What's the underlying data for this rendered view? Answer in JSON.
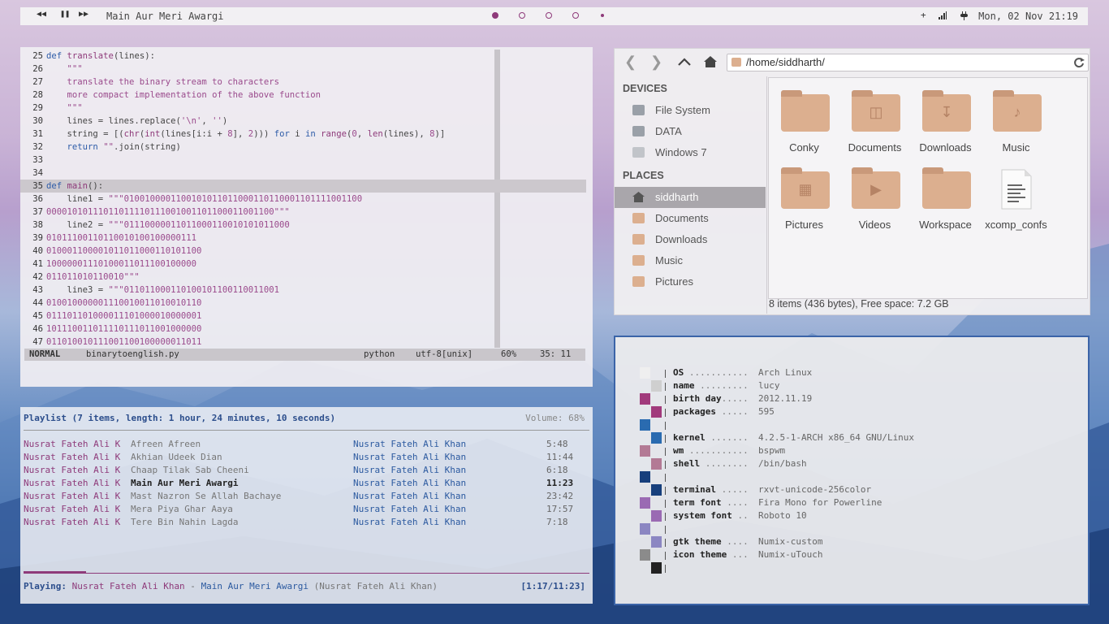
{
  "colors": {
    "accent": "#8e3a7a",
    "blue": "#2c4e8c",
    "folder": "#dcaf8f"
  },
  "topbar": {
    "prev_icon": "⏮",
    "pause_icon": "⏸",
    "next_icon": "⏭",
    "now_playing": "Main Aur Meri Awargi",
    "tray_plus": "+",
    "signal_icon": "📶",
    "power_icon": "🔌",
    "clock": "Mon, 02 Nov 21:19"
  },
  "vim": {
    "lines": [
      {
        "n": "25",
        "html": "<span class=\"kw\">def</span> <span class=\"fn\">translate</span>(lines):"
      },
      {
        "n": "26",
        "html": "    <span class=\"com\">\"\"\"</span>"
      },
      {
        "n": "27",
        "html": "    <span class=\"com\">translate the binary stream to characters</span>"
      },
      {
        "n": "28",
        "html": "    <span class=\"com\">more compact implementation of the above function</span>"
      },
      {
        "n": "29",
        "html": "    <span class=\"com\">\"\"\"</span>"
      },
      {
        "n": "30",
        "html": "    lines = lines.replace(<span class=\"str\">'\\n'</span>, <span class=\"str\">''</span>)"
      },
      {
        "n": "31",
        "html": "    string = [(<span class=\"fn\">chr</span>(<span class=\"fn\">int</span>(lines[i:i + <span class=\"str\">8</span>], <span class=\"str\">2</span>))) <span class=\"kw\">for</span> i <span class=\"kw\">in</span> <span class=\"fn\">range</span>(<span class=\"str\">0</span>, <span class=\"fn\">len</span>(lines), <span class=\"str\">8</span>)]"
      },
      {
        "n": "32",
        "html": "    <span class=\"kw\">return</span> <span class=\"str\">\"\"</span>.join(string)"
      },
      {
        "n": "33",
        "html": ""
      },
      {
        "n": "34",
        "html": ""
      },
      {
        "n": "35",
        "html": "<span class=\"kw\">def</span> <span class=\"fn\">main</span>():"
      },
      {
        "n": "36",
        "html": "    line1 = <span class=\"str\">\"\"\"0100100001100101011011000110110001101111001100</span>"
      },
      {
        "n": "37",
        "html": "<span class=\"str\">00001010111011011110111001001101100011001100\"\"\"</span>"
      },
      {
        "n": "38",
        "html": "    line2 = <span class=\"str\">\"\"\"01110000011011000110010101011000</span>"
      },
      {
        "n": "39",
        "html": "<span class=\"str\">01011100110110010100100000111</span>"
      },
      {
        "n": "40",
        "html": "<span class=\"str\">01000110000101101100011010110​0</span>"
      },
      {
        "n": "41",
        "html": "<span class=\"str\">10000001110100011011100100000</span>"
      },
      {
        "n": "42",
        "html": "<span class=\"str\">011011010110010\"\"\"</span>"
      },
      {
        "n": "43",
        "html": "    line3 = <span class=\"str\">\"\"\"011011000110100101100110011001</span>"
      },
      {
        "n": "44",
        "html": "<span class=\"str\">01001000000111001001101001011​0</span>"
      },
      {
        "n": "45",
        "html": "<span class=\"str\">01110110100001110100001000000​1</span>"
      },
      {
        "n": "46",
        "html": "<span class=\"str\">10111001101111011101100100000​0</span>"
      },
      {
        "n": "47",
        "html": "<span class=\"str\">01101001011100110010000001101​1</span>"
      }
    ],
    "mode": "NORMAL",
    "file": "binarytoenglish.py",
    "filetype": "python",
    "encoding": "utf-8[unix]",
    "percent": "60%",
    "position": "35: 11"
  },
  "fm": {
    "path": "/home/siddharth/",
    "back_icon": "‹",
    "forward_icon": "›",
    "up_icon": "^",
    "home_icon": "⌂",
    "reload_icon": "↻",
    "devices_heading": "DEVICES",
    "devices": [
      "File System",
      "DATA",
      "Windows 7"
    ],
    "places_heading": "PLACES",
    "places": [
      "siddharth",
      "Documents",
      "Downloads",
      "Music",
      "Pictures"
    ],
    "items": [
      "Conky",
      "Documents",
      "Downloads",
      "Music",
      "Pictures",
      "Videos",
      "Workspace",
      "xcomp_confs"
    ],
    "status": "8 items (436 bytes), Free space: 7.2 GB"
  },
  "mpd": {
    "header": "Playlist (7 items, length: 1 hour, 24 minutes, 10 seconds)",
    "volume": "Volume: 68%",
    "rows": [
      {
        "artist": "Nusrat Fateh Ali K",
        "title": "Afreen Afreen",
        "album": "Nusrat Fateh Ali Khan",
        "dur": "5:48"
      },
      {
        "artist": "Nusrat Fateh Ali K",
        "title": "Akhian Udeek Dian",
        "album": "Nusrat Fateh Ali Khan",
        "dur": "11:44"
      },
      {
        "artist": "Nusrat Fateh Ali K",
        "title": "Chaap Tilak Sab Cheeni",
        "album": "Nusrat Fateh Ali Khan",
        "dur": "6:18"
      },
      {
        "artist": "Nusrat Fateh Ali K",
        "title": "Main Aur Meri Awargi",
        "album": "Nusrat Fateh Ali Khan",
        "dur": "11:23"
      },
      {
        "artist": "Nusrat Fateh Ali K",
        "title": "Mast Nazron Se Allah Bachaye",
        "album": "Nusrat Fateh Ali Khan",
        "dur": "23:42"
      },
      {
        "artist": "Nusrat Fateh Ali K",
        "title": "Mera Piya Ghar Aaya",
        "album": "Nusrat Fateh Ali Khan",
        "dur": "17:57"
      },
      {
        "artist": "Nusrat Fateh Ali K",
        "title": "Tere Bin Nahin Lagda",
        "album": "Nusrat Fateh Ali Khan",
        "dur": "7:18"
      }
    ],
    "progress_fraction": 0.11,
    "playing_label": "Playing:",
    "playing_artist": "Nusrat Fateh Ali Khan",
    "playing_sep": " - ",
    "playing_title": "Main Aur Meri Awargi",
    "playing_album": "(Nusrat Fateh Ali Khan)",
    "time": "[1:17/11:23]"
  },
  "info": {
    "rows": [
      {
        "k": "OS",
        "dots": " ...........",
        "v": "Arch Linux"
      },
      {
        "k": "name",
        "dots": " .........",
        "v": "lucy"
      },
      {
        "k": "birth day",
        "dots": ".....",
        "v": "2012.11.19"
      },
      {
        "k": "packages",
        "dots": " .....",
        "v": "595"
      },
      {
        "k": "",
        "dots": "",
        "v": ""
      },
      {
        "k": "kernel",
        "dots": " .......",
        "v": "4.2.5-1-ARCH x86_64 GNU/Linux"
      },
      {
        "k": "wm",
        "dots": " ...........",
        "v": "bspwm"
      },
      {
        "k": "shell",
        "dots": " ........",
        "v": "/bin/bash"
      },
      {
        "k": "",
        "dots": "",
        "v": ""
      },
      {
        "k": "terminal",
        "dots": " .....",
        "v": "rxvt-unicode-256color"
      },
      {
        "k": "term font",
        "dots": " ....",
        "v": "Fira Mono for Powerline"
      },
      {
        "k": "system font",
        "dots": " ..",
        "v": "Roboto 10"
      },
      {
        "k": "",
        "dots": "",
        "v": ""
      },
      {
        "k": "gtk theme",
        "dots": " ....",
        "v": "Numix-custom"
      },
      {
        "k": "icon theme",
        "dots": " ...",
        "v": "Numix-uTouch"
      }
    ],
    "swatches": [
      [
        "#efefef",
        "#cfcfcf"
      ],
      [
        "#a13a7c",
        "#a13a7c"
      ],
      [
        "#2a6bb0",
        "#2a6bb0"
      ],
      [
        "#b37a95",
        "#b37a95"
      ],
      [
        "#173f7c",
        "#173f7c"
      ],
      [
        "#9a6ab3",
        "#9a6ab3"
      ],
      [
        "#8b86c2",
        "#8b86c2"
      ],
      [
        "#8b8b8b",
        "#222222"
      ]
    ]
  }
}
